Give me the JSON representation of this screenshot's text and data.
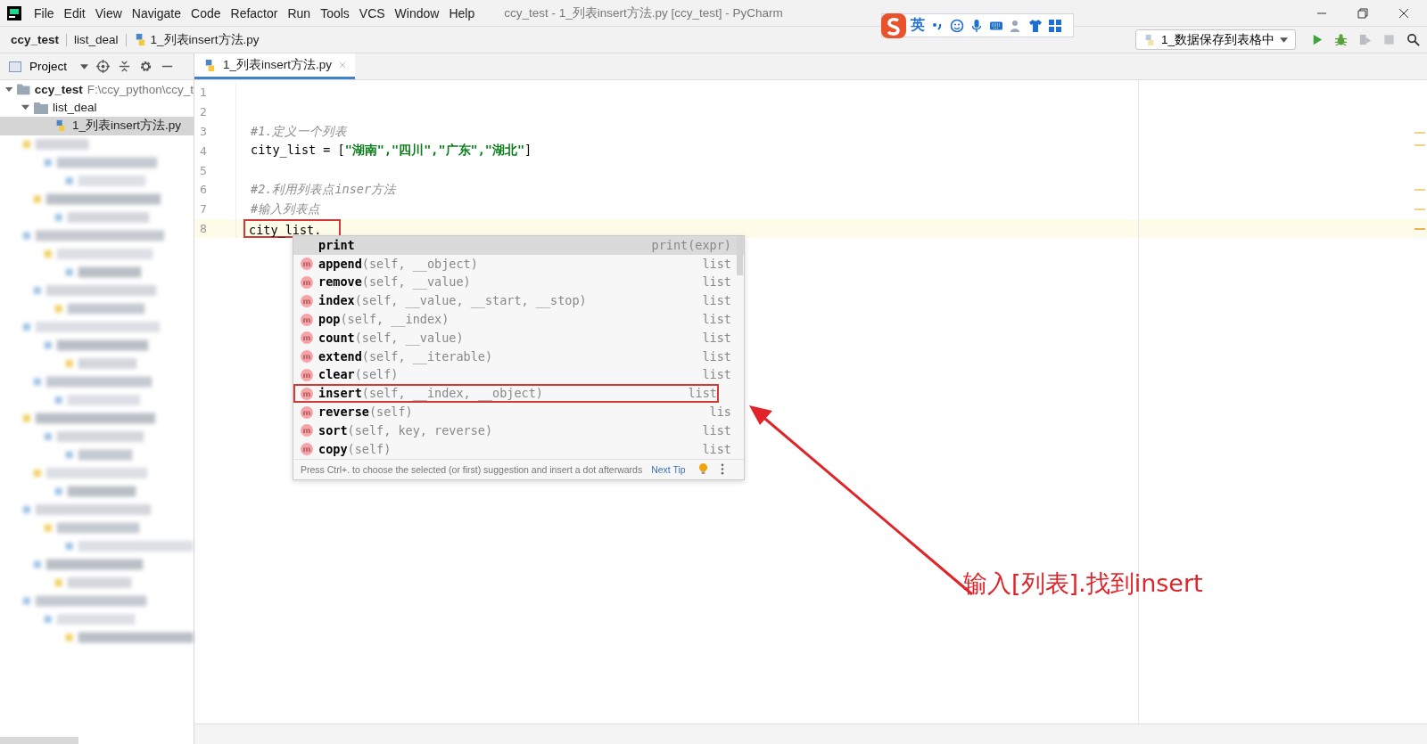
{
  "window": {
    "title": "ccy_test - 1_列表insert方法.py [ccy_test] - PyCharm"
  },
  "menu": [
    "File",
    "Edit",
    "View",
    "Navigate",
    "Code",
    "Refactor",
    "Run",
    "Tools",
    "VCS",
    "Window",
    "Help"
  ],
  "ime_toolbar": {
    "mode": "英"
  },
  "breadcrumbs": [
    {
      "label": "ccy_test",
      "kind": "project"
    },
    {
      "label": "list_deal",
      "kind": "folder"
    },
    {
      "label": "1_列表insert方法.py",
      "kind": "file"
    }
  ],
  "run_config": {
    "label": "1_数据保存到表格中"
  },
  "project_panel": {
    "title": "Project"
  },
  "tree": [
    {
      "label": "ccy_test",
      "path": "F:\\ccy_python\\ccy_t",
      "kind": "project",
      "expanded": true,
      "selected": false,
      "children": [
        {
          "label": "list_deal",
          "kind": "folder",
          "expanded": true,
          "selected": false,
          "children": [
            {
              "label": "1_列表insert方法.py",
              "kind": "file",
              "selected": true
            }
          ]
        }
      ]
    }
  ],
  "tabs": [
    {
      "label": "1_列表insert方法.py",
      "selected": true
    }
  ],
  "code_lines": [
    {
      "number": "1",
      "current": false,
      "boxed": false
    },
    {
      "number": "2",
      "current": false,
      "boxed": false
    },
    {
      "number": "3",
      "current": false,
      "boxed": false,
      "tokens": [
        {
          "kind": "comment",
          "text": "#1.定义一个列表"
        }
      ]
    },
    {
      "number": "4",
      "current": false,
      "boxed": false,
      "tokens": [
        {
          "kind": "plain",
          "text": "city_list = ["
        },
        {
          "kind": "string",
          "text": "\"湖南\",\"四川\",\"广东\",\"湖北\""
        },
        {
          "kind": "plain",
          "text": "]"
        }
      ]
    },
    {
      "number": "5",
      "current": false,
      "boxed": false
    },
    {
      "number": "6",
      "current": false,
      "boxed": false,
      "tokens": [
        {
          "kind": "comment",
          "text": "#2.利用列表点inser方法"
        }
      ]
    },
    {
      "number": "7",
      "current": false,
      "boxed": false,
      "tokens": [
        {
          "kind": "comment",
          "text": "#输入列表点"
        }
      ]
    },
    {
      "number": "8",
      "current": true,
      "boxed": true,
      "tokens": [
        {
          "kind": "plain",
          "text": "city_list."
        }
      ]
    }
  ],
  "completion": {
    "items": [
      {
        "kind": "template",
        "name": "print",
        "type": "print(expr)",
        "selected": true,
        "boxed": false
      },
      {
        "kind": "method",
        "name": "append",
        "params": "(self, __object)",
        "type": "list",
        "selected": false,
        "boxed": false
      },
      {
        "kind": "method",
        "name": "remove",
        "params": "(self, __value)",
        "type": "list",
        "selected": false,
        "boxed": false
      },
      {
        "kind": "method",
        "name": "index",
        "params": "(self, __value, __start, __stop)",
        "type": "list",
        "selected": false,
        "boxed": false
      },
      {
        "kind": "method",
        "name": "pop",
        "params": "(self, __index)",
        "type": "list",
        "selected": false,
        "boxed": false
      },
      {
        "kind": "method",
        "name": "count",
        "params": "(self, __value)",
        "type": "list",
        "selected": false,
        "boxed": false
      },
      {
        "kind": "method",
        "name": "extend",
        "params": "(self, __iterable)",
        "type": "list",
        "selected": false,
        "boxed": false
      },
      {
        "kind": "method",
        "name": "clear",
        "params": "(self)",
        "type": "list",
        "selected": false,
        "boxed": false
      },
      {
        "kind": "method",
        "name": "insert",
        "params": "(self, __index, __object)",
        "type": "list",
        "selected": false,
        "boxed": true
      },
      {
        "kind": "method",
        "name": "reverse",
        "params": "(self)",
        "type": "lis",
        "selected": false,
        "boxed": false
      },
      {
        "kind": "method",
        "name": "sort",
        "params": "(self, key, reverse)",
        "type": "list",
        "selected": false,
        "boxed": false
      },
      {
        "kind": "method",
        "name": "copy",
        "params": "(self)",
        "type": "list",
        "selected": false,
        "boxed": false
      }
    ],
    "hint": "Press Ctrl+. to choose the selected (or first) suggestion and insert a dot afterwards",
    "next_tip": "Next Tip"
  },
  "annotation": {
    "text": "输入[列表].找到insert"
  }
}
